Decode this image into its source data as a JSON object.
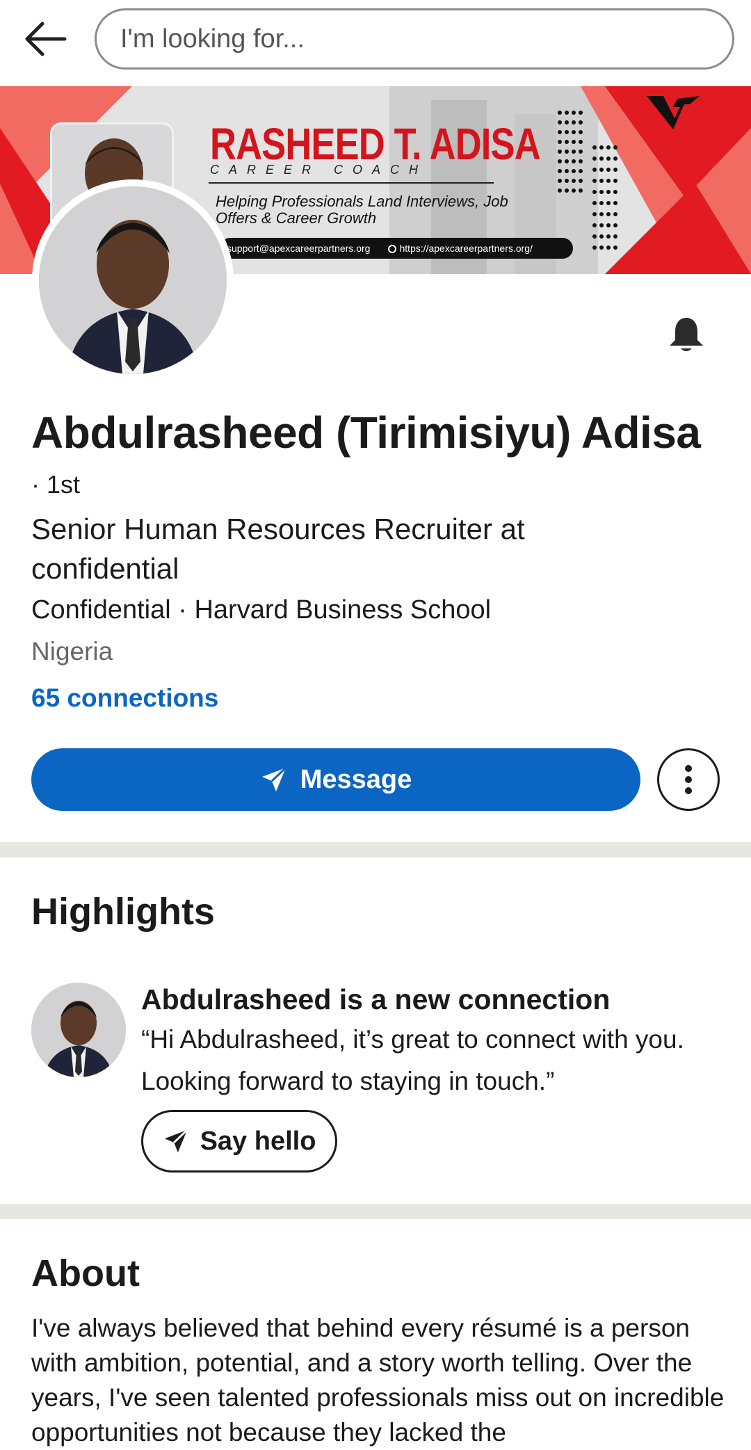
{
  "search": {
    "placeholder": "I'm looking for..."
  },
  "banner": {
    "name": "RASHEED T. ADISA",
    "subtitle": "CAREER COACH",
    "tagline": "Helping Professionals Land Interviews, Job Offers & Career Growth",
    "email": "support@apexcareerpartners.org",
    "website": "https://apexcareerpartners.org/",
    "accent_color": "#d3141c"
  },
  "profile": {
    "name": "Abdulrasheed (Tirimisiyu) Adisa",
    "degree": "· 1st",
    "headline": "Senior Human Resources Recruiter at confidential",
    "meta": "Confidential · Harvard Business School",
    "location": "Nigeria",
    "connections": "65 connections"
  },
  "actions": {
    "message_label": "Message",
    "more_icon": "more-vertical-icon",
    "bell_icon": "bell-icon"
  },
  "highlights": {
    "title": "Highlights",
    "item_title": "Abdulrasheed is a new connection",
    "item_quote": "“Hi Abdulrasheed, it’s great to connect with you. Looking forward to staying in touch.”",
    "say_hello_label": "Say hello"
  },
  "about": {
    "title": "About",
    "text": "I've always believed that behind every résumé is a person with ambition, potential, and a story worth telling. Over the years, I've seen talented professionals miss out on incredible opportunities not because they lacked the"
  },
  "colors": {
    "primary": "#0a66c2",
    "divider": "#e8e6e1"
  }
}
